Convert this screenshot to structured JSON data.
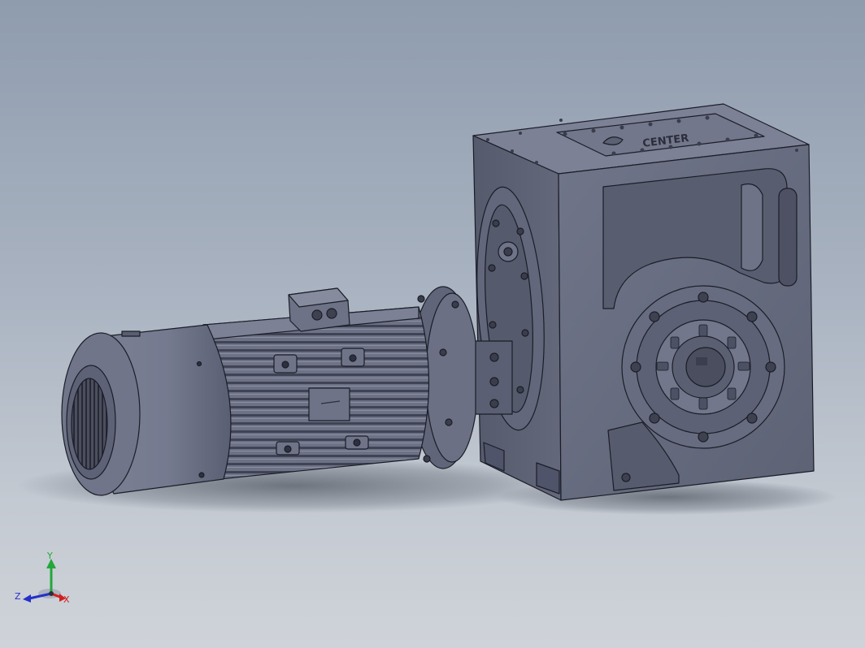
{
  "viewport": {
    "background_top": "#8f9cae",
    "background_bottom": "#cfd3d9",
    "model_color": "#6a6f85",
    "edge_color": "#1b1d26"
  },
  "gearbox": {
    "logo_text": "CENTER"
  },
  "triad": {
    "x_label": "X",
    "y_label": "Y",
    "z_label": "Z",
    "x_color": "#d21f1f",
    "y_color": "#22a83a",
    "z_color": "#2430c8"
  }
}
